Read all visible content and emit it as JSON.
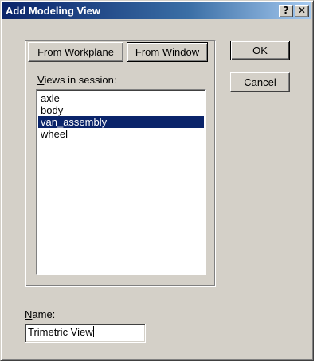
{
  "window": {
    "title": "Add Modeling View",
    "help_label": "?",
    "close_label": "✕"
  },
  "buttons": {
    "ok": "OK",
    "cancel": "Cancel"
  },
  "source_tabs": {
    "from_workplane": "From Workplane",
    "from_window": "From Window"
  },
  "views": {
    "label_mnemonic": "V",
    "label_rest": "iews in session:",
    "items": [
      {
        "label": "axle",
        "selected": false
      },
      {
        "label": "body",
        "selected": false
      },
      {
        "label": "van_assembly",
        "selected": true
      },
      {
        "label": "wheel",
        "selected": false
      }
    ]
  },
  "name_field": {
    "label_mnemonic": "N",
    "label_rest": "ame:",
    "value": "Trimetric View"
  },
  "colors": {
    "dialog_face": "#d4d0c8",
    "title_bar_start": "#0a246a",
    "selection": "#0a246a"
  }
}
